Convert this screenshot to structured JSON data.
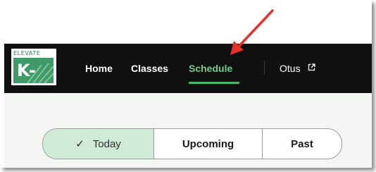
{
  "logo": {
    "top_text": "ELEVATE",
    "main_text": "K-12",
    "brand_color": "#3f9a67"
  },
  "nav": {
    "items": [
      {
        "label": "Home",
        "active": false
      },
      {
        "label": "Classes",
        "active": false
      },
      {
        "label": "Schedule",
        "active": true
      },
      {
        "label": "Otus",
        "external": true,
        "icon": "external-link-icon"
      }
    ],
    "active_color": "#6fcf8e"
  },
  "schedule_filter": {
    "options": [
      {
        "label": "Today",
        "selected": true,
        "icon": "check-icon"
      },
      {
        "label": "Upcoming",
        "selected": false
      },
      {
        "label": "Past",
        "selected": false
      }
    ],
    "selected_bg": "#cfead7"
  },
  "annotation": {
    "type": "arrow",
    "color": "#e53128",
    "points_to": "Schedule"
  }
}
